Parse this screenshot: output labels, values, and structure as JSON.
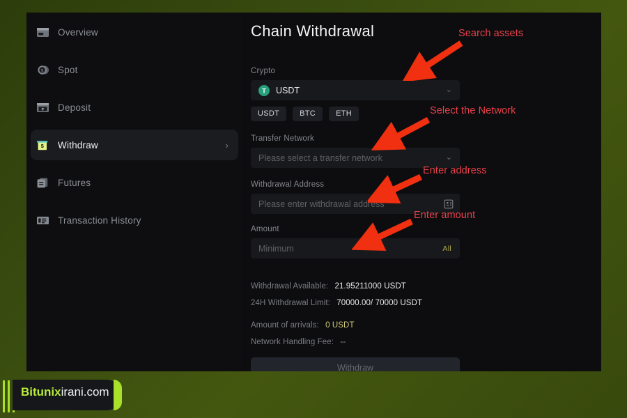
{
  "sidebar": {
    "items": [
      {
        "label": "Overview",
        "icon": "card-overview-icon",
        "active": false
      },
      {
        "label": "Spot",
        "icon": "coins-icon",
        "active": false
      },
      {
        "label": "Deposit",
        "icon": "deposit-card-icon",
        "active": false
      },
      {
        "label": "Withdraw",
        "icon": "withdraw-cash-icon",
        "active": true
      },
      {
        "label": "Futures",
        "icon": "futures-docs-icon",
        "active": false
      },
      {
        "label": "Transaction History",
        "icon": "history-list-icon",
        "active": false
      }
    ],
    "active_chevron": "›"
  },
  "main": {
    "title": "Chain Withdrawal",
    "crypto": {
      "label": "Crypto",
      "selected": "USDT",
      "token_glyph": "T",
      "chevron": "⌄",
      "chips": [
        "USDT",
        "BTC",
        "ETH"
      ]
    },
    "transfer_network": {
      "label": "Transfer Network",
      "placeholder": "Please select a transfer network",
      "value": "",
      "chevron": "⌄"
    },
    "withdrawal_address": {
      "label": "Withdrawal Address",
      "placeholder": "Please enter withdrawal address",
      "value": "",
      "book_icon": "address-book-icon"
    },
    "amount": {
      "label": "Amount",
      "placeholder": "Minimum",
      "value": "",
      "all_label": "All"
    },
    "info": [
      {
        "key": "Withdrawal Available:",
        "value": "21.95211000 USDT",
        "style": "normal"
      },
      {
        "key": "24H Withdrawal Limit:",
        "value": "70000.00/ 70000 USDT",
        "style": "normal"
      }
    ],
    "info2": [
      {
        "key": "Amount of arrivals:",
        "value": "0 USDT",
        "style": "accent"
      },
      {
        "key": "Network Handling Fee:",
        "value": "--",
        "style": "muted"
      }
    ],
    "submit_label": "Withdraw"
  },
  "annotations": [
    {
      "text": "Search assets",
      "target": "crypto-select"
    },
    {
      "text": "Select the Network",
      "target": "transfer-network-select"
    },
    {
      "text": "Enter address",
      "target": "withdrawal-address-input"
    },
    {
      "text": "Enter amount",
      "target": "amount-input"
    }
  ],
  "watermark": {
    "brand": "Bitunix",
    "rest": "irani.com"
  },
  "colors": {
    "accent_green": "#26a17b",
    "annotation_red": "#e8404a",
    "arrow_red": "#f03010",
    "brand_green": "#b9ee3a",
    "panel_bg": "#0d0d0f"
  }
}
